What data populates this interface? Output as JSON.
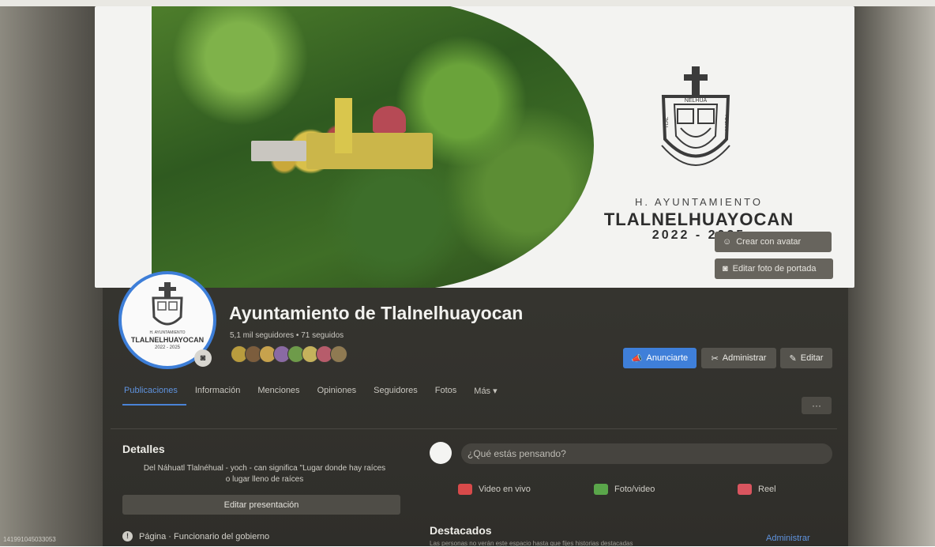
{
  "page": {
    "name": "Ayuntamiento de Tlalnelhuayocan",
    "followers_line": "5,1 mil seguidores • 71 seguidos"
  },
  "cover": {
    "city_small": "H. AYUNTAMIENTO",
    "city_big": "TLALNELHUAYOCAN",
    "city_years": "2022 - 2025",
    "seal_top_text": "NELHUA",
    "seal_left_text": "TLAL",
    "seal_right_text": "YOCAN",
    "btn_avatar": "Crear con avatar",
    "btn_cover": "Editar foto de portada"
  },
  "avatar": {
    "line1": "H. AYUNTAMIENTO",
    "line2": "TLALNELHUAYOCAN",
    "line3": "2022 - 2025"
  },
  "actions": {
    "advertise": "Anunciarte",
    "manage": "Administrar",
    "edit": "Editar"
  },
  "tabs": [
    {
      "label": "Publicaciones",
      "active": true
    },
    {
      "label": "Información",
      "active": false
    },
    {
      "label": "Menciones",
      "active": false
    },
    {
      "label": "Opiniones",
      "active": false
    },
    {
      "label": "Seguidores",
      "active": false
    },
    {
      "label": "Fotos",
      "active": false
    },
    {
      "label": "Más ▾",
      "active": false
    }
  ],
  "tabs_more": "···",
  "details": {
    "title": "Detalles",
    "desc_line1": "Del Náhuatl Tlalnéhual - yoch - can significa \"Lugar donde hay raíces",
    "desc_line2": "o lugar lleno de raíces",
    "edit_intro": "Editar presentación",
    "category": "Página · Funcionario del gobierno"
  },
  "composer": {
    "placeholder": "¿Qué estás pensando?",
    "live": "Video en vivo",
    "photo": "Foto/video",
    "reel": "Reel"
  },
  "featured": {
    "title": "Destacados",
    "subtitle": "Las personas no verán este espacio hasta que fijes historias destacadas",
    "manage": "Administrar"
  },
  "side_id": "141991045033053",
  "colors": {
    "accent_blue": "#3f7fd9",
    "tab_active": "#5f93de"
  }
}
